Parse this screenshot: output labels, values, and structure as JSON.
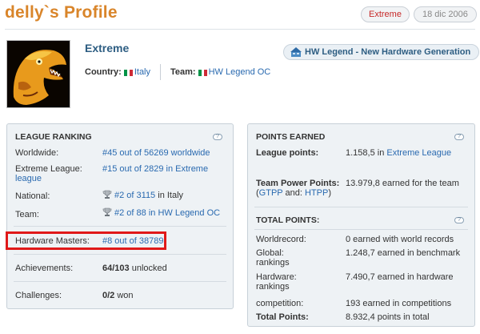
{
  "header": {
    "title": "delly`s Profile",
    "level_badge": "Extreme",
    "date_badge": "18 dic 2006"
  },
  "profile": {
    "username": "Extreme",
    "country_label": "Country:",
    "country_value": "Italy",
    "team_label": "Team:",
    "team_value": "HW Legend OC",
    "team_pill": "HW Legend - New Hardware Generation"
  },
  "league_ranking": {
    "heading": "LEAGUE RANKING",
    "worldwide_label": "Worldwide:",
    "worldwide_value": "#45 out of 56269 worldwide",
    "extreme_label_1": "Extreme League:",
    "extreme_label_2": "league",
    "extreme_value": "#15 out of 2829 in Extreme",
    "national_label": "National:",
    "national_rank": "#2 of 3115",
    "national_suffix": "in Italy",
    "team_label": "Team:",
    "team_rank": "#2 of 88",
    "team_suffix": "in HW Legend OC",
    "hwmasters_label": "Hardware Masters:",
    "hwmasters_value": "#8 out of 38789",
    "achievements_label": "Achievements:",
    "achievements_value": "64/103",
    "achievements_suffix": "unlocked",
    "challenges_label": "Challenges:",
    "challenges_value": "0/2",
    "challenges_suffix": "won"
  },
  "points_earned": {
    "heading": "POINTS EARNED",
    "league_label": "League points:",
    "league_value": "1.158,5 in",
    "league_link": "Extreme League",
    "tpp_label": "Team Power Points:",
    "tpp_sub_open": "(",
    "tpp_sub_gtpp": "GTPP",
    "tpp_sub_and": " and: ",
    "tpp_sub_htpp": "HTPP",
    "tpp_sub_close": ")",
    "tpp_value": "13.979,8 earned for the team"
  },
  "total_points": {
    "heading": "TOTAL POINTS:",
    "worldrecord_label": "Worldrecord:",
    "worldrecord_value": "0 earned with world records",
    "global_label_1": "Global:",
    "global_label_2": "rankings",
    "global_value": "1.248,7 earned in benchmark",
    "hardware_label_1": "Hardware:",
    "hardware_label_2": "rankings",
    "hardware_value": "7.490,7 earned in hardware",
    "competition_label": "competition:",
    "competition_value": "193 earned in competitions",
    "total_label": "Total Points:",
    "total_value": "8.932,4 points in total"
  },
  "colors": {
    "title": "#d9852a",
    "link": "#2a6ab0",
    "highlight": "#e01919",
    "badge_level": "#c62828"
  }
}
